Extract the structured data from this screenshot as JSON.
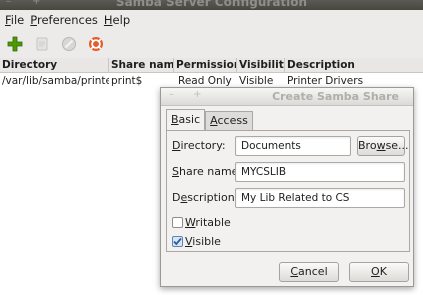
{
  "window": {
    "title": "Samba Server Configuration",
    "controls": "–  +"
  },
  "menu": [
    {
      "label": "File",
      "mnemonic": "F",
      "rest": "ile"
    },
    {
      "label": "Preferences",
      "mnemonic": "P",
      "rest": "references"
    },
    {
      "label": "Help",
      "mnemonic": "H",
      "rest": "elp"
    }
  ],
  "toolbar": {
    "icons": [
      "add-share-icon",
      "properties-icon",
      "delete-share-icon",
      "help-icon"
    ],
    "colors": {
      "add": "#4e9a06",
      "help": "#e85b2d"
    }
  },
  "table": {
    "columns": [
      "Directory",
      "Share name",
      "Permissions",
      "Visibility",
      "Description"
    ],
    "rows": [
      {
        "directory": "/var/lib/samba/printers",
        "share": "print$",
        "permissions": "Read Only",
        "visibility": "Visible",
        "description": "Printer Drivers"
      }
    ]
  },
  "dialog": {
    "title": "Create Samba Share",
    "controls": "–  +",
    "tabs": [
      {
        "label": "Basic",
        "mnemonic": "B",
        "rest": "asic",
        "active": true
      },
      {
        "label": "Access",
        "mnemonic": "A",
        "rest": "ccess",
        "active": false
      }
    ],
    "directory": {
      "label": "Directory:",
      "mnemonic": "D",
      "rest": "irectory:",
      "value": "Documents"
    },
    "browse_button": {
      "pre": "Bro",
      "mnemonic": "w",
      "rest": "se..."
    },
    "share_name": {
      "label": "Share name:",
      "mnemonic": "S",
      "rest": "hare name:",
      "value": "MYCSLIB"
    },
    "description": {
      "label": "Description:",
      "pre": "D",
      "mnemonic": "e",
      "rest": "scription:",
      "value": "My Lib Related to CS"
    },
    "writable": {
      "label": "Writable",
      "mnemonic": "W",
      "rest": "ritable",
      "checked": false
    },
    "visible": {
      "label": "Visible",
      "mnemonic": "V",
      "rest": "isible",
      "checked": true
    },
    "cancel_button": {
      "mnemonic": "C",
      "rest": "ancel"
    },
    "ok_button": {
      "mnemonic": "O",
      "rest": "K"
    }
  }
}
